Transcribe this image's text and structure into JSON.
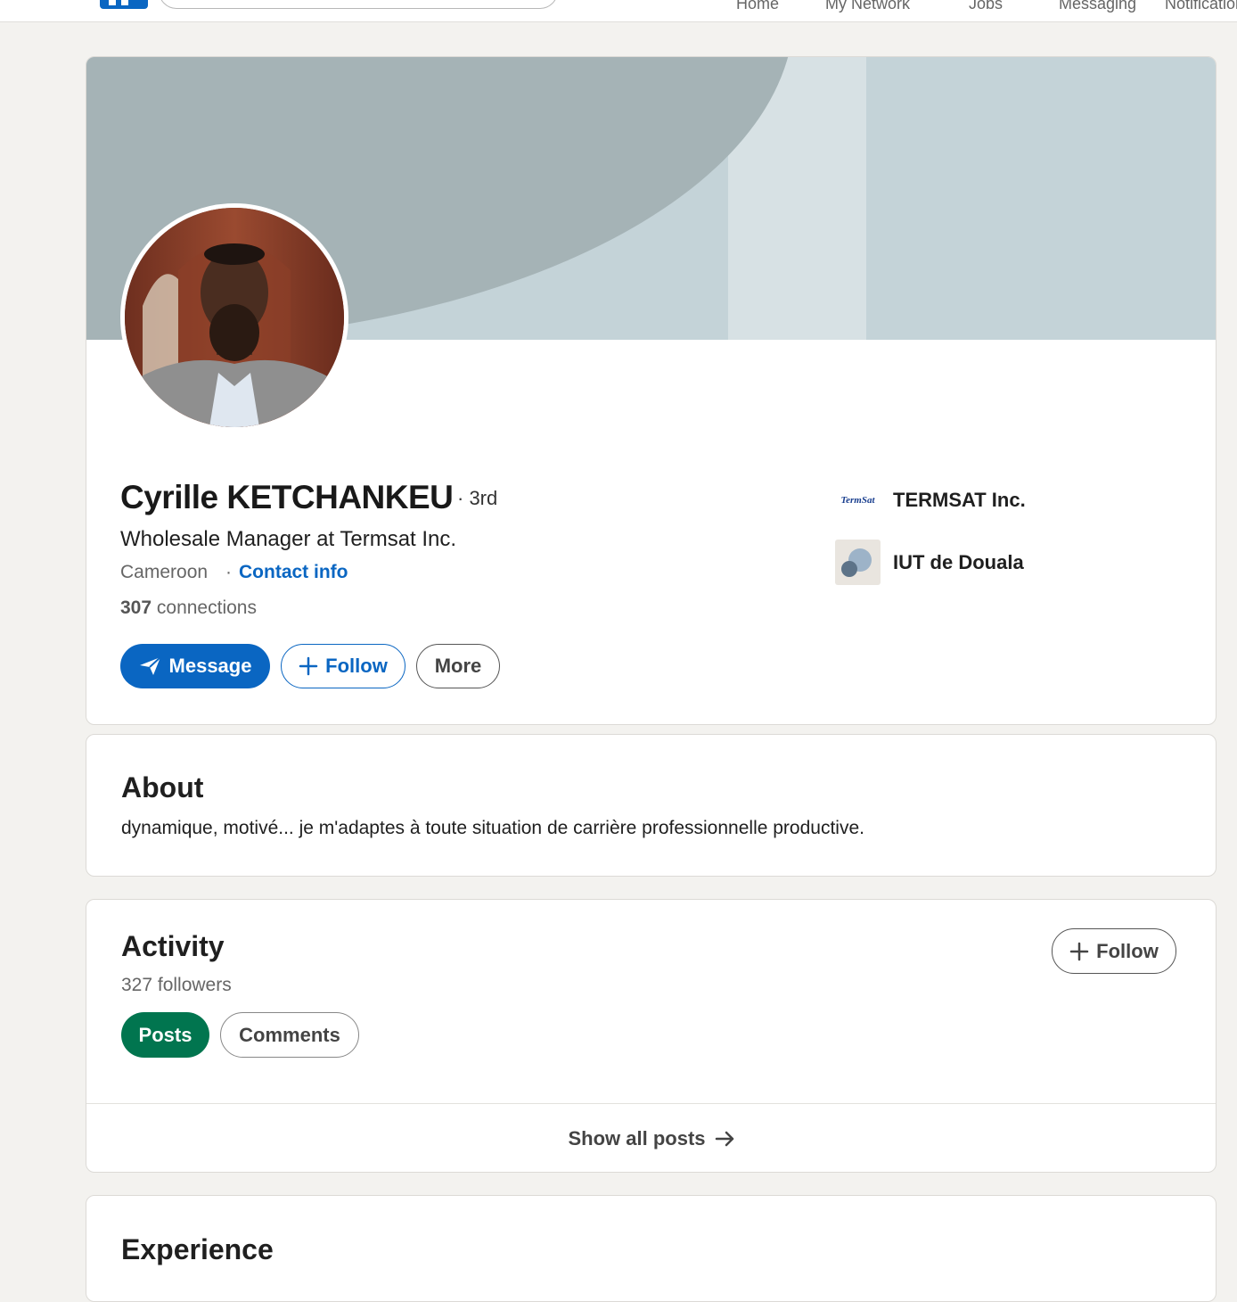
{
  "nav": {
    "items": [
      "Home",
      "My Network",
      "Jobs",
      "Messaging",
      "Notifications"
    ]
  },
  "profile": {
    "name": "Cyrille KETCHANKEU",
    "degree": "· 3rd",
    "headline": "Wholesale Manager at Termsat Inc.",
    "location": "Cameroon",
    "separator": "·",
    "contact_info": "Contact info",
    "connections_count": "307",
    "connections_label": "connections",
    "actions": {
      "message": "Message",
      "follow": "Follow",
      "more": "More"
    },
    "organizations": [
      {
        "name": "TERMSAT Inc.",
        "logo_text": "TermSat"
      },
      {
        "name": "IUT de Douala"
      }
    ]
  },
  "about": {
    "title": "About",
    "text": "dynamique, motivé... je m'adaptes à toute situation de carrière professionnelle productive."
  },
  "activity": {
    "title": "Activity",
    "followers": "327 followers",
    "follow_button": "Follow",
    "tabs": [
      "Posts",
      "Comments"
    ],
    "active_tab": "Posts",
    "show_all": "Show all posts"
  },
  "experience": {
    "title": "Experience"
  },
  "colors": {
    "brand_blue": "#0a66c2",
    "active_tab_green": "#01754f",
    "page_background": "#f3f2ef"
  }
}
